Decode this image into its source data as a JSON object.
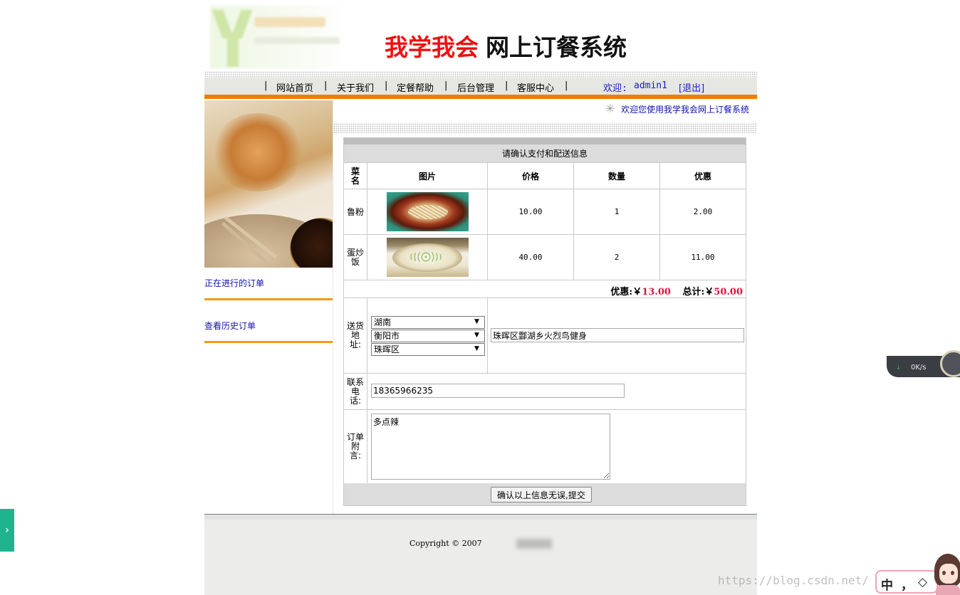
{
  "header": {
    "title_red": "我学我会",
    "title_black": "网上订餐系统"
  },
  "nav": {
    "items": [
      "网站首页",
      "关于我们",
      "定餐帮助",
      "后台管理",
      "客服中心"
    ],
    "separator": "|",
    "welcome_label": "欢迎:",
    "username": "admin1",
    "logout": "[退出]"
  },
  "sidebar": {
    "links": [
      "正在进行的订单",
      "查看历史订单"
    ]
  },
  "marquee": {
    "message": "欢迎您使用我学我会网上订餐系统"
  },
  "order": {
    "caption": "请确认支付和配送信息",
    "columns": {
      "name": "菜名",
      "image": "图片",
      "price": "价格",
      "quantity": "数量",
      "discount": "优惠"
    },
    "rows": [
      {
        "name": "鲁粉",
        "price": "10.00",
        "quantity": "1",
        "discount": "2.00"
      },
      {
        "name": "蛋炒饭",
        "price": "40.00",
        "quantity": "2",
        "discount": "11.00"
      }
    ],
    "summary": {
      "discount_label": "优惠:￥",
      "discount_value": "13.00",
      "total_label": "总计:￥",
      "total_value": "50.00"
    },
    "address": {
      "label": "送货地址:",
      "province": "湖南",
      "city": "衡阳市",
      "district": "珠晖区",
      "detail": "珠晖区酃湖乡火烈鸟健身"
    },
    "phone": {
      "label": "联系电话:",
      "value": "18365966235"
    },
    "note": {
      "label": "订单附言:",
      "value": "多点辣"
    },
    "submit_label": "确认以上信息无误,提交"
  },
  "footer": {
    "copyright": "Copyright © 2007"
  },
  "overlays": {
    "left_tab_arrow": "›",
    "speed_rate": "0K/s",
    "speed_arrow": "↓",
    "watermark": "https://blog.csdn.net/",
    "ime_items": [
      "中",
      "，",
      "◇"
    ]
  },
  "colors": {
    "accent_orange": "#ef7d00",
    "title_red": "#ee1111",
    "link_blue": "#1111aa",
    "price_red": "#e0103c"
  }
}
